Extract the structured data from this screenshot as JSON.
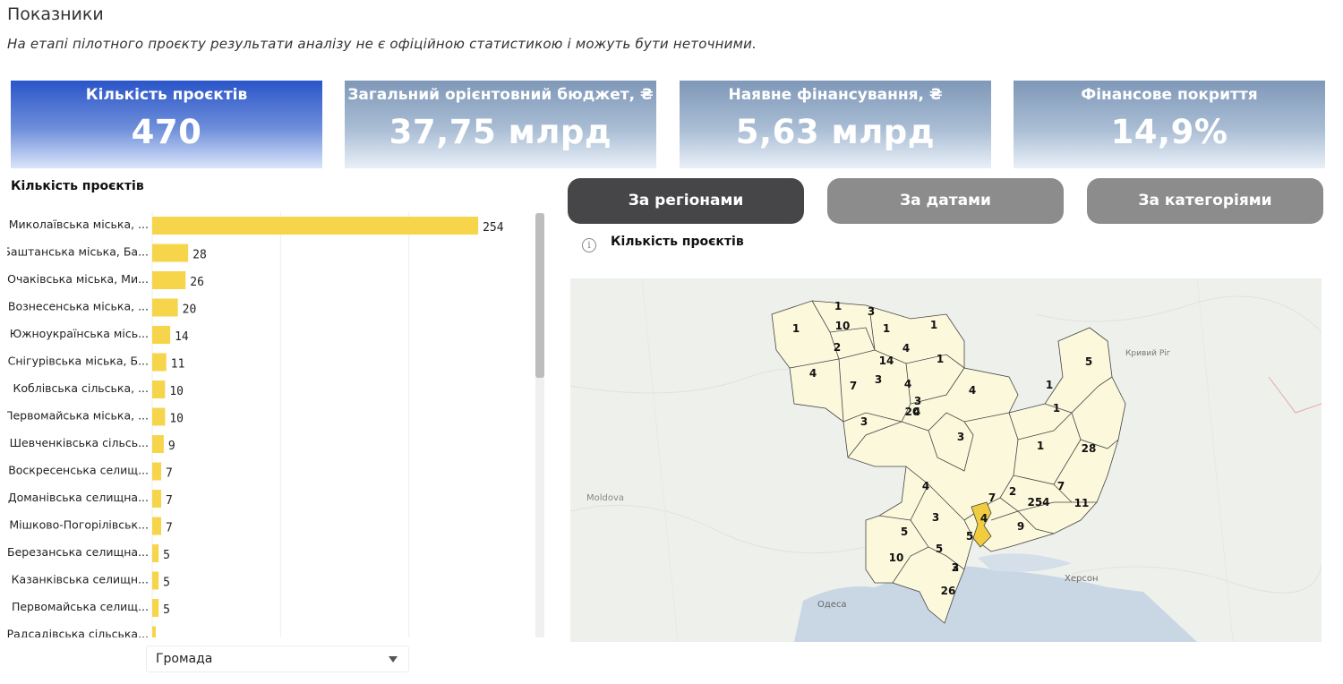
{
  "header": {
    "title": "Показники",
    "subtitle": "На етапі пілотного проєкту результати аналізу не є офіційною статистикою і можуть бути неточними."
  },
  "kpis": [
    {
      "label": "Кількість проєктів",
      "value": "470"
    },
    {
      "label": "Загальний орієнтовний бюджет, ₴",
      "value": "37,75 млрд"
    },
    {
      "label": "Наявне фінансування, ₴",
      "value": "5,63 млрд"
    },
    {
      "label": "Фінансове покриття",
      "value": "14,9%"
    }
  ],
  "bar_section": {
    "title": "Кількість проєктів",
    "dropdown_value": "Громада"
  },
  "tabs": [
    {
      "label": "За регіонами"
    },
    {
      "label": "За датами"
    },
    {
      "label": "За категоріями"
    }
  ],
  "map_section": {
    "title": "Кількість проєктів",
    "info_icon": "info-icon",
    "place_labels": [
      "Moldova",
      "Одеса",
      "Херсон",
      "Кривий Ріг"
    ],
    "region_values": [
      "1",
      "3",
      "1",
      "10",
      "1",
      "1",
      "2",
      "4",
      "4",
      "1",
      "14",
      "5",
      "4",
      "7",
      "3",
      "1",
      "4",
      "1",
      "4",
      "20",
      "3",
      "3",
      "3",
      "1",
      "28",
      "4",
      "2",
      "7",
      "7",
      "3",
      "4",
      "254",
      "5",
      "11",
      "5",
      "5",
      "9",
      "10",
      "3",
      "2",
      "26"
    ]
  },
  "colors": {
    "bar": "#f7d54a",
    "highlight_region": "#f0cc3e",
    "region_fill": "#fbf8dc",
    "tab_active": "#464648",
    "tab_inactive": "#8c8c8c",
    "kpi_active": "#2a55c9"
  },
  "chart_data": {
    "type": "bar",
    "orientation": "horizontal",
    "categories": [
      "Миколаївська міська, ...",
      "Баштанська міська, Ба...",
      "Очаківська міська, Ми...",
      "Вознесенська міська, ...",
      "Южноукраїнська місь...",
      "Снігурівська міська, Б...",
      "Коблівська сільська, ...",
      "Первомайська міська, ...",
      "Шевченківська сільсь...",
      "Воскресенська селищ...",
      "Доманівська селищна...",
      "Мішково-Погорілівськ...",
      "Березанська селищна...",
      "Казанківська селищн...",
      "Первомайська селищ...",
      "Радсадівська сільська..."
    ],
    "values": [
      254,
      28,
      26,
      20,
      14,
      11,
      10,
      10,
      9,
      7,
      7,
      7,
      5,
      5,
      5,
      null
    ],
    "xlim": [
      0,
      300
    ],
    "grid": true
  }
}
